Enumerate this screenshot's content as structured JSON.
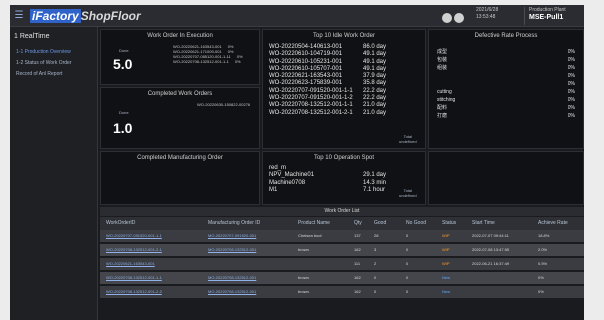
{
  "app": {
    "brand_highlight": "iFactory",
    "brand_rest": "ShopFloor",
    "user_line1": "2021/6/28",
    "user_line2": "13:53:48",
    "org_line1": "Production Plant",
    "org_name": "MSE-Pull1"
  },
  "sidebar": {
    "title": "1 RealTime",
    "items": [
      {
        "label": "1-1 Production Overview",
        "active": true
      },
      {
        "label": "1-2 Status of Work Order",
        "active": false
      },
      {
        "label": "Record of Anl Report",
        "active": false
      }
    ]
  },
  "panels": {
    "work_order_execution": {
      "title": "Work Order In Execution",
      "label": "Done",
      "value": "5.0",
      "items": [
        {
          "id": "WO-20220621-163543-001",
          "pct": "0%"
        },
        {
          "id": "WO-20220621-171009-001",
          "pct": "0%"
        },
        {
          "id": "WO-20220707-085120-001-1-11",
          "pct": "0%"
        },
        {
          "id": "WO-20220708-132512-001-1-1",
          "pct": "0%"
        }
      ]
    },
    "completed_work_orders": {
      "title": "Completed Work Orders",
      "label": "Done",
      "value": "1.0",
      "items": [
        {
          "id": "WO-20220630-150822-00276",
          "pct": ""
        }
      ]
    },
    "completed_mfg_order": {
      "title": "Completed Manufacturing Order"
    },
    "top10_idle": {
      "title": "Top 10 Idle Work Order",
      "rows": [
        {
          "id": "WO-20220504-140613-001",
          "val": "86.0 day"
        },
        {
          "id": "WO-20220610-104719-001",
          "val": "49.1 day"
        },
        {
          "id": "WO-20220610-105231-001",
          "val": "49.1 day"
        },
        {
          "id": "WO-20220610-105707-001",
          "val": "49.1 day"
        },
        {
          "id": "WO-20220621-163543-001",
          "val": "37.9 day"
        },
        {
          "id": "WO-20220623-175839-001",
          "val": "35.8 day"
        },
        {
          "id": "WO-20220707-091520-001-1-1",
          "val": "22.2 day"
        },
        {
          "id": "WO-20220707-091520-001-1-2",
          "val": "22.2 day"
        },
        {
          "id": "WO-20220708-132512-001-1-1",
          "val": "21.0 day"
        },
        {
          "id": "WO-20220708-132512-001-2-1",
          "val": "21.0 day"
        }
      ],
      "total_label": "Total",
      "total_value": "undefined"
    },
    "top10_operation": {
      "title": "Top 10 Operation Spot",
      "rows": [
        {
          "id": "red_m",
          "val": ""
        },
        {
          "id": "NPV_Machine01",
          "val": "29.1 day"
        },
        {
          "id": "Machine0708",
          "val": "14.3 min"
        },
        {
          "id": "M1",
          "val": "7.1 hour"
        }
      ],
      "total_label": "Total",
      "total_value": "undefined"
    },
    "defective_rate": {
      "title": "Defective Rate Process",
      "rows": [
        {
          "name": "成型",
          "val": "0%"
        },
        {
          "name": "包装",
          "val": "0%"
        },
        {
          "name": "组装",
          "val": "0%"
        },
        {
          "name": "",
          "val": "0%"
        },
        {
          "name": "",
          "val": "0%"
        },
        {
          "name": "cutting",
          "val": "0%"
        },
        {
          "name": "stitching",
          "val": "0%"
        },
        {
          "name": "配料",
          "val": "0%"
        },
        {
          "name": "打磨",
          "val": "0%"
        }
      ]
    }
  },
  "work_order_list": {
    "title": "Work Order List",
    "columns": [
      "WorkOrderID",
      "Manufacturing Order ID",
      "Product Name",
      "Qty",
      "Good",
      "No Good",
      "Status",
      "Start Time",
      "Achieve Rate"
    ],
    "rows": [
      [
        "WO-20220707-091520-001-1-1",
        "MO-20220707-091520-001",
        "Chelsea boot",
        "137",
        "28",
        "0",
        "WIP",
        "2022-07-07 09:44:11",
        "18.8%"
      ],
      [
        "WO-20220708-132512-001-2-1",
        "MO-20220708-132512-001",
        "brown",
        "162",
        "3",
        "0",
        "WIP",
        "2022-07-08 13:47:55",
        "2.0%"
      ],
      [
        "WO-20220621-163543-001",
        "",
        "",
        "111",
        "2",
        "0",
        "WIP",
        "2022-06-21 16:37:49",
        "0.5%"
      ],
      [
        "WO-20220708-132512-001-1-1",
        "MO-20220708-132512-001",
        "brown",
        "162",
        "0",
        "0",
        "New",
        "",
        "0%"
      ],
      [
        "WO-20220708-132512-001-2-2",
        "MO-20220708-132512-001",
        "brown",
        "162",
        "0",
        "0",
        "New",
        "",
        "0%"
      ]
    ]
  },
  "colors": {
    "background": "#1a1b1f",
    "panel": "#101114",
    "accent": "#2f63c9",
    "status_wip": "#ff9b2a",
    "status_new": "#5ea7ff"
  }
}
